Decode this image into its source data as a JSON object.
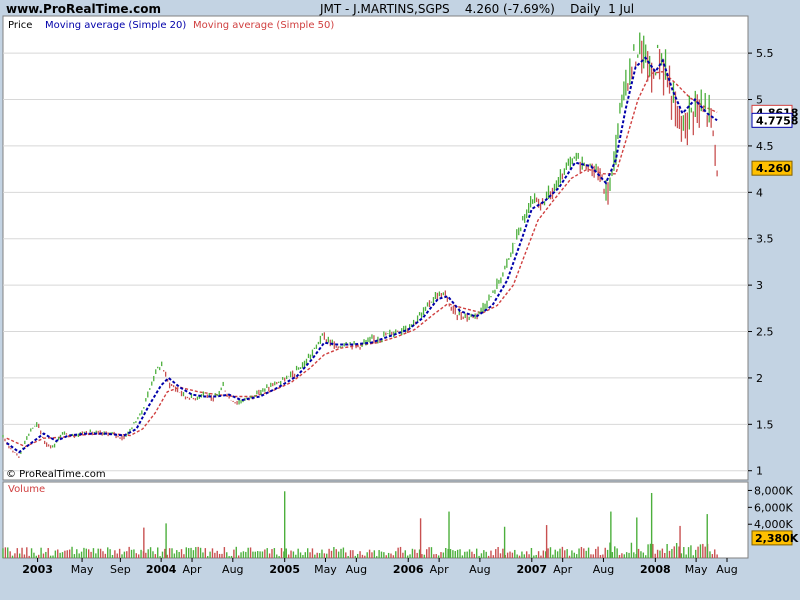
{
  "header": {
    "site": "www.ProRealTime.com",
    "title": "JMT - J.MARTINS,SGPS    4.260 (-7.69%)    Daily  1 Jul"
  },
  "chart_data": [
    {
      "type": "line",
      "panel": "price",
      "legend": {
        "price": "Price",
        "ma20": "Moving average (Simple 20)",
        "ma50": "Moving average (Simple 50)"
      },
      "watermark": "© ProRealTime.com",
      "ylim": [
        0.9,
        5.9
      ],
      "yticks": [
        {
          "v": 1,
          "label": "1"
        },
        {
          "v": 1.5,
          "label": "1.5"
        },
        {
          "v": 2,
          "label": "2"
        },
        {
          "v": 2.5,
          "label": "2.5"
        },
        {
          "v": 3,
          "label": "3"
        },
        {
          "v": 3.5,
          "label": "3.5"
        },
        {
          "v": 4,
          "label": "4"
        },
        {
          "v": 4.5,
          "label": "4.5"
        },
        {
          "v": 5,
          "label": "5"
        },
        {
          "v": 5.5,
          "label": "5.5"
        }
      ],
      "badges": [
        {
          "label": "4.8618",
          "value": 4.8618,
          "kind": "ma50"
        },
        {
          "label": "4.7758",
          "value": 4.7758,
          "kind": "ma20"
        },
        {
          "label": "4.260",
          "value": 4.26,
          "kind": "price"
        }
      ],
      "x_labels": [
        {
          "t": 2003.0,
          "label": "2003",
          "bold": true
        },
        {
          "t": 2003.36,
          "label": "May",
          "bold": false
        },
        {
          "t": 2003.67,
          "label": "Sep",
          "bold": false
        },
        {
          "t": 2004.0,
          "label": "2004",
          "bold": true
        },
        {
          "t": 2004.25,
          "label": "Apr",
          "bold": false
        },
        {
          "t": 2004.58,
          "label": "Aug",
          "bold": false
        },
        {
          "t": 2005.0,
          "label": "2005",
          "bold": true
        },
        {
          "t": 2005.33,
          "label": "May",
          "bold": false
        },
        {
          "t": 2005.58,
          "label": "Aug",
          "bold": false
        },
        {
          "t": 2006.0,
          "label": "2006",
          "bold": true
        },
        {
          "t": 2006.25,
          "label": "Apr",
          "bold": false
        },
        {
          "t": 2006.58,
          "label": "Aug",
          "bold": false
        },
        {
          "t": 2007.0,
          "label": "2007",
          "bold": true
        },
        {
          "t": 2007.25,
          "label": "Apr",
          "bold": false
        },
        {
          "t": 2007.58,
          "label": "Aug",
          "bold": false
        },
        {
          "t": 2008.0,
          "label": "2008",
          "bold": true
        },
        {
          "t": 2008.33,
          "label": "May",
          "bold": false
        },
        {
          "t": 2008.58,
          "label": "Aug",
          "bold": false
        }
      ],
      "x_range": [
        2002.72,
        2008.75
      ],
      "price_series": [
        [
          2002.72,
          1.35
        ],
        [
          2002.8,
          1.22
        ],
        [
          2002.85,
          1.15
        ],
        [
          2002.9,
          1.32
        ],
        [
          2002.95,
          1.45
        ],
        [
          2003.0,
          1.5
        ],
        [
          2003.06,
          1.3
        ],
        [
          2003.12,
          1.25
        ],
        [
          2003.2,
          1.4
        ],
        [
          2003.3,
          1.38
        ],
        [
          2003.4,
          1.42
        ],
        [
          2003.5,
          1.4
        ],
        [
          2003.6,
          1.4
        ],
        [
          2003.7,
          1.35
        ],
        [
          2003.78,
          1.5
        ],
        [
          2003.85,
          1.65
        ],
        [
          2003.9,
          1.85
        ],
        [
          2003.95,
          2.05
        ],
        [
          2004.0,
          2.15
        ],
        [
          2004.06,
          1.95
        ],
        [
          2004.12,
          1.88
        ],
        [
          2004.2,
          1.8
        ],
        [
          2004.28,
          1.78
        ],
        [
          2004.35,
          1.85
        ],
        [
          2004.42,
          1.75
        ],
        [
          2004.5,
          1.92
        ],
        [
          2004.55,
          1.78
        ],
        [
          2004.62,
          1.73
        ],
        [
          2004.7,
          1.78
        ],
        [
          2004.8,
          1.85
        ],
        [
          2004.9,
          1.92
        ],
        [
          2005.0,
          1.98
        ],
        [
          2005.08,
          2.05
        ],
        [
          2005.16,
          2.15
        ],
        [
          2005.24,
          2.3
        ],
        [
          2005.3,
          2.45
        ],
        [
          2005.36,
          2.4
        ],
        [
          2005.42,
          2.32
        ],
        [
          2005.5,
          2.38
        ],
        [
          2005.6,
          2.35
        ],
        [
          2005.7,
          2.4
        ],
        [
          2005.8,
          2.45
        ],
        [
          2005.9,
          2.5
        ],
        [
          2006.0,
          2.55
        ],
        [
          2006.06,
          2.62
        ],
        [
          2006.12,
          2.7
        ],
        [
          2006.18,
          2.82
        ],
        [
          2006.24,
          2.9
        ],
        [
          2006.3,
          2.88
        ],
        [
          2006.36,
          2.72
        ],
        [
          2006.42,
          2.68
        ],
        [
          2006.5,
          2.65
        ],
        [
          2006.58,
          2.72
        ],
        [
          2006.66,
          2.85
        ],
        [
          2006.74,
          3.05
        ],
        [
          2006.82,
          3.3
        ],
        [
          2006.9,
          3.6
        ],
        [
          2007.0,
          3.9
        ],
        [
          2007.06,
          3.85
        ],
        [
          2007.12,
          3.95
        ],
        [
          2007.2,
          4.05
        ],
        [
          2007.28,
          4.25
        ],
        [
          2007.36,
          4.38
        ],
        [
          2007.42,
          4.3
        ],
        [
          2007.5,
          4.25
        ],
        [
          2007.55,
          4.2
        ],
        [
          2007.6,
          3.95
        ],
        [
          2007.65,
          4.2
        ],
        [
          2007.7,
          4.7
        ],
        [
          2007.75,
          5.1
        ],
        [
          2007.8,
          5.35
        ],
        [
          2007.86,
          5.55
        ],
        [
          2007.92,
          5.45
        ],
        [
          2007.98,
          5.2
        ],
        [
          2008.02,
          5.5
        ],
        [
          2008.08,
          5.3
        ],
        [
          2008.14,
          5.0
        ],
        [
          2008.2,
          4.7
        ],
        [
          2008.26,
          4.8
        ],
        [
          2008.32,
          4.95
        ],
        [
          2008.38,
          4.85
        ],
        [
          2008.44,
          4.9
        ],
        [
          2008.47,
          4.62
        ],
        [
          2008.5,
          4.26
        ]
      ],
      "ma20_series": [
        [
          2002.75,
          1.3
        ],
        [
          2002.85,
          1.2
        ],
        [
          2002.95,
          1.3
        ],
        [
          2003.05,
          1.4
        ],
        [
          2003.15,
          1.32
        ],
        [
          2003.25,
          1.38
        ],
        [
          2003.4,
          1.4
        ],
        [
          2003.55,
          1.4
        ],
        [
          2003.7,
          1.38
        ],
        [
          2003.8,
          1.45
        ],
        [
          2003.9,
          1.7
        ],
        [
          2004.0,
          1.92
        ],
        [
          2004.06,
          2.0
        ],
        [
          2004.15,
          1.9
        ],
        [
          2004.25,
          1.82
        ],
        [
          2004.35,
          1.8
        ],
        [
          2004.45,
          1.8
        ],
        [
          2004.55,
          1.82
        ],
        [
          2004.65,
          1.76
        ],
        [
          2004.8,
          1.8
        ],
        [
          2004.95,
          1.9
        ],
        [
          2005.1,
          2.02
        ],
        [
          2005.22,
          2.2
        ],
        [
          2005.32,
          2.38
        ],
        [
          2005.42,
          2.36
        ],
        [
          2005.55,
          2.36
        ],
        [
          2005.7,
          2.38
        ],
        [
          2005.85,
          2.45
        ],
        [
          2006.0,
          2.52
        ],
        [
          2006.12,
          2.65
        ],
        [
          2006.24,
          2.85
        ],
        [
          2006.32,
          2.88
        ],
        [
          2006.42,
          2.72
        ],
        [
          2006.55,
          2.66
        ],
        [
          2006.68,
          2.78
        ],
        [
          2006.8,
          3.05
        ],
        [
          2006.92,
          3.5
        ],
        [
          2007.0,
          3.82
        ],
        [
          2007.1,
          3.9
        ],
        [
          2007.22,
          4.05
        ],
        [
          2007.35,
          4.32
        ],
        [
          2007.48,
          4.28
        ],
        [
          2007.6,
          4.1
        ],
        [
          2007.68,
          4.35
        ],
        [
          2007.76,
          4.9
        ],
        [
          2007.84,
          5.35
        ],
        [
          2007.92,
          5.45
        ],
        [
          2008.0,
          5.3
        ],
        [
          2008.06,
          5.42
        ],
        [
          2008.14,
          5.1
        ],
        [
          2008.22,
          4.85
        ],
        [
          2008.32,
          5.0
        ],
        [
          2008.42,
          4.85
        ],
        [
          2008.5,
          4.7758
        ]
      ],
      "ma50_series": [
        [
          2002.75,
          1.35
        ],
        [
          2002.9,
          1.26
        ],
        [
          2003.05,
          1.35
        ],
        [
          2003.2,
          1.36
        ],
        [
          2003.4,
          1.39
        ],
        [
          2003.6,
          1.4
        ],
        [
          2003.75,
          1.38
        ],
        [
          2003.85,
          1.45
        ],
        [
          2003.95,
          1.62
        ],
        [
          2004.05,
          1.85
        ],
        [
          2004.15,
          1.9
        ],
        [
          2004.3,
          1.85
        ],
        [
          2004.45,
          1.82
        ],
        [
          2004.6,
          1.8
        ],
        [
          2004.75,
          1.8
        ],
        [
          2004.9,
          1.86
        ],
        [
          2005.05,
          1.95
        ],
        [
          2005.2,
          2.1
        ],
        [
          2005.32,
          2.25
        ],
        [
          2005.45,
          2.32
        ],
        [
          2005.6,
          2.35
        ],
        [
          2005.75,
          2.38
        ],
        [
          2005.9,
          2.44
        ],
        [
          2006.05,
          2.52
        ],
        [
          2006.2,
          2.68
        ],
        [
          2006.32,
          2.8
        ],
        [
          2006.45,
          2.75
        ],
        [
          2006.6,
          2.7
        ],
        [
          2006.72,
          2.78
        ],
        [
          2006.85,
          3.0
        ],
        [
          2006.95,
          3.35
        ],
        [
          2007.05,
          3.7
        ],
        [
          2007.18,
          3.92
        ],
        [
          2007.32,
          4.15
        ],
        [
          2007.45,
          4.25
        ],
        [
          2007.58,
          4.2
        ],
        [
          2007.68,
          4.2
        ],
        [
          2007.76,
          4.55
        ],
        [
          2007.86,
          5.0
        ],
        [
          2007.96,
          5.28
        ],
        [
          2008.06,
          5.3
        ],
        [
          2008.16,
          5.18
        ],
        [
          2008.28,
          5.02
        ],
        [
          2008.4,
          4.92
        ],
        [
          2008.5,
          4.8618
        ]
      ],
      "colors": {
        "price": "#4caf3c",
        "price_down": "#c85050",
        "ma20": "#0000aa",
        "ma50": "#d04040"
      }
    },
    {
      "type": "bar",
      "panel": "volume",
      "legend": "Volume",
      "ylim": [
        0,
        9000
      ],
      "yticks": [
        {
          "v": 4000,
          "label": "4,000K"
        },
        {
          "v": 6000,
          "label": "6,000K"
        },
        {
          "v": 8000,
          "label": "8,000K"
        }
      ],
      "badge": {
        "label": "2,380K",
        "value": 2380
      },
      "spikes": [
        [
          2005.0,
          7900
        ],
        [
          2004.04,
          4100
        ],
        [
          2003.86,
          3600
        ],
        [
          2007.97,
          7700
        ],
        [
          2007.64,
          5500
        ],
        [
          2006.1,
          4700
        ],
        [
          2006.33,
          5500
        ],
        [
          2006.78,
          3700
        ],
        [
          2007.12,
          3900
        ],
        [
          2008.42,
          5200
        ],
        [
          2007.85,
          4800
        ],
        [
          2008.2,
          3800
        ]
      ],
      "base_volume": 700,
      "colors": {
        "up": "#4caf3c",
        "down": "#c85050"
      }
    }
  ]
}
